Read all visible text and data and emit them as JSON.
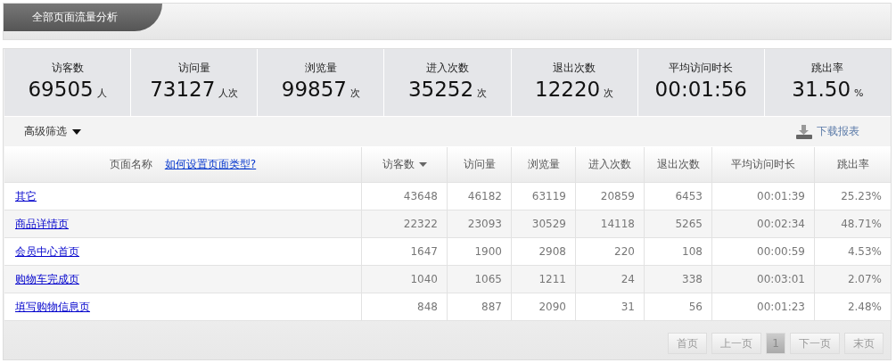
{
  "header": {
    "title": "全部页面流量分析"
  },
  "stats": [
    {
      "label": "访客数",
      "value": "69505",
      "unit": "人"
    },
    {
      "label": "访问量",
      "value": "73127",
      "unit": "人次"
    },
    {
      "label": "浏览量",
      "value": "99857",
      "unit": "次"
    },
    {
      "label": "进入次数",
      "value": "35252",
      "unit": "次"
    },
    {
      "label": "退出次数",
      "value": "12220",
      "unit": "次"
    },
    {
      "label": "平均访问时长",
      "value": "00:01:56"
    },
    {
      "label": "跳出率",
      "value": "31.50",
      "unit": "%"
    }
  ],
  "filter": {
    "label": "高级筛选"
  },
  "download": {
    "label": "下载报表"
  },
  "table": {
    "name_column": {
      "label": "页面名称",
      "help_link": "如何设置页面类型?"
    },
    "columns": [
      {
        "label": "访客数",
        "sorted": true
      },
      {
        "label": "访问量",
        "sorted": false
      },
      {
        "label": "浏览量",
        "sorted": false
      },
      {
        "label": "进入次数",
        "sorted": false
      },
      {
        "label": "退出次数",
        "sorted": false
      },
      {
        "label": "平均访问时长",
        "sorted": false
      },
      {
        "label": "跳出率",
        "sorted": false
      }
    ],
    "rows": [
      {
        "name": "其它",
        "cells": [
          "43648",
          "46182",
          "63119",
          "20859",
          "6453",
          "00:01:39",
          "25.23%"
        ]
      },
      {
        "name": "商品详情页",
        "cells": [
          "22322",
          "23093",
          "30529",
          "14118",
          "5265",
          "00:02:34",
          "48.71%"
        ]
      },
      {
        "name": "会员中心首页",
        "cells": [
          "1647",
          "1900",
          "2908",
          "220",
          "108",
          "00:00:59",
          "4.53%"
        ]
      },
      {
        "name": "购物车完成页",
        "cells": [
          "1040",
          "1065",
          "1211",
          "24",
          "338",
          "00:03:01",
          "2.07%"
        ]
      },
      {
        "name": "填写购物信息页",
        "cells": [
          "848",
          "887",
          "2090",
          "31",
          "56",
          "00:01:23",
          "2.48%"
        ]
      }
    ]
  },
  "pagination": {
    "first": "首页",
    "prev": "上一页",
    "pages": [
      {
        "label": "1",
        "selected": true
      }
    ],
    "next": "下一页",
    "last": "末页"
  }
}
